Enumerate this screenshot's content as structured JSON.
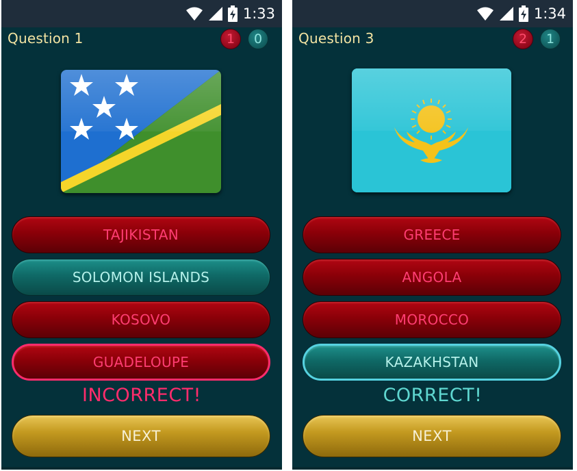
{
  "left": {
    "status": {
      "time": "1:33"
    },
    "question": "Question 1",
    "score": {
      "wrong": "1",
      "right": "0"
    },
    "flag_icon": "solomon-islands-flag",
    "answers": [
      {
        "label": "TAJIKISTAN",
        "state": "red"
      },
      {
        "label": "SOLOMON ISLANDS",
        "state": "teal"
      },
      {
        "label": "KOSOVO",
        "state": "red"
      },
      {
        "label": "GUADELOUPE",
        "state": "selected-wrong"
      }
    ],
    "result": "INCORRECT!",
    "next": "NEXT"
  },
  "right": {
    "status": {
      "time": "1:34"
    },
    "question": "Question 3",
    "score": {
      "wrong": "2",
      "right": "1"
    },
    "flag_icon": "kazakhstan-flag",
    "answers": [
      {
        "label": "GREECE",
        "state": "red"
      },
      {
        "label": "ANGOLA",
        "state": "red"
      },
      {
        "label": "MOROCCO",
        "state": "red"
      },
      {
        "label": "KAZAKHSTAN",
        "state": "selected-right"
      }
    ],
    "result": "CORRECT!",
    "next": "NEXT"
  },
  "colors": {
    "background": "#04313a",
    "status_bar": "#1f2d3b",
    "question_text": "#f2e3a2",
    "answer_red_text": "#ff3d73",
    "answer_teal_text": "#b5f1ea",
    "incorrect": "#ff2c6c",
    "correct": "#5fd7d0",
    "next_button": "#c49a20"
  }
}
